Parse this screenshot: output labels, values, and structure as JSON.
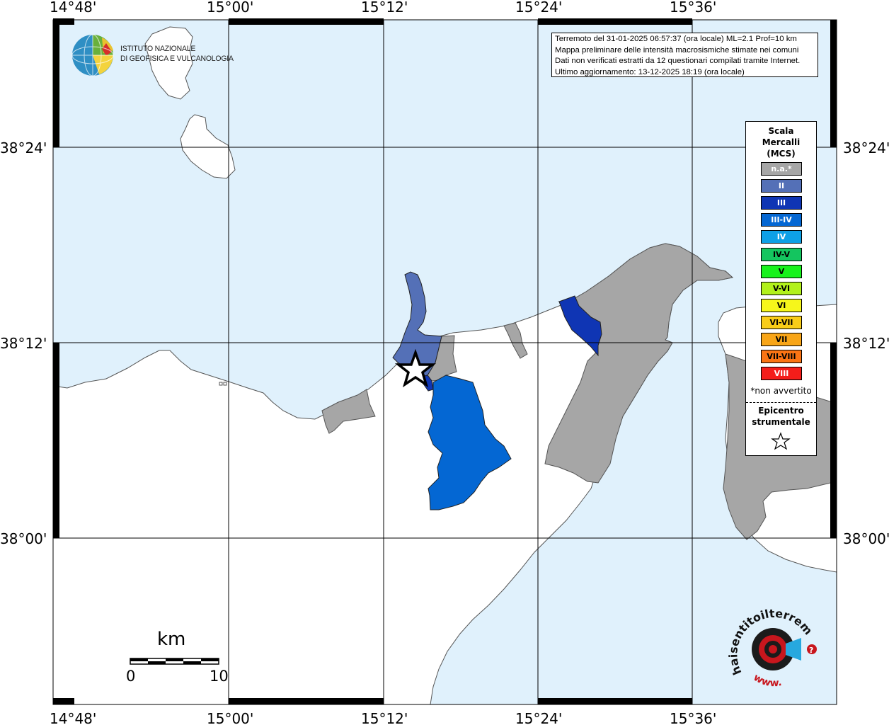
{
  "map": {
    "lon_labels": [
      "14°48'",
      "15°00'",
      "15°12'",
      "15°24'",
      "15°36'"
    ],
    "lat_labels": [
      "38°24'",
      "38°12'",
      "38°00'"
    ],
    "epicenter_marker": "star-icon",
    "colors": {
      "sea": "#e0f1fc",
      "land": "#ffffff",
      "not_felt": "#a6a6a6",
      "intensity_II": "#5470b7",
      "intensity_III": "#0f35b4",
      "intensity_III_IV": "#0467d3"
    }
  },
  "info": {
    "line1": "Terremoto del 31-01-2025 06:57:37 (ora locale) ML=2.1 Prof=10 km",
    "line2": "Mappa preliminare delle intensità macrosismiche stimate nei comuni",
    "line3": "Dati non verificati estratti da 12 questionari compilati tramite Internet.",
    "line4": "Ultimo aggiornamento: 13-12-2025 18:19 (ora locale)"
  },
  "legend": {
    "title_line1": "Scala",
    "title_line2": "Mercalli",
    "title_line3": "(MCS)",
    "items": [
      {
        "label": "n.a.*",
        "color": "#a6a6a6",
        "text_color": "#ffffff"
      },
      {
        "label": "II",
        "color": "#5470b7",
        "text_color": "#ffffff"
      },
      {
        "label": "III",
        "color": "#0f35b4",
        "text_color": "#ffffff"
      },
      {
        "label": "III-IV",
        "color": "#0467d3",
        "text_color": "#ffffff"
      },
      {
        "label": "IV",
        "color": "#0ea0e6",
        "text_color": "#ffffff"
      },
      {
        "label": "IV-V",
        "color": "#14c55f",
        "text_color": "#000000"
      },
      {
        "label": "V",
        "color": "#17f21c",
        "text_color": "#000000"
      },
      {
        "label": "V-VI",
        "color": "#b2f11b",
        "text_color": "#000000"
      },
      {
        "label": "VI",
        "color": "#f6f61b",
        "text_color": "#000000"
      },
      {
        "label": "VI-VII",
        "color": "#f9cd18",
        "text_color": "#000000"
      },
      {
        "label": "VII",
        "color": "#f8a517",
        "text_color": "#000000"
      },
      {
        "label": "VII-VIII",
        "color": "#fa7414",
        "text_color": "#000000"
      },
      {
        "label": "VIII",
        "color": "#f41d1a",
        "text_color": "#ffffff"
      }
    ],
    "note": "*non avvertito",
    "epicenter_line1": "Epicentro",
    "epicenter_line2": "strumentale"
  },
  "logos": {
    "ingv_line1": "ISTITUTO NAZIONALE",
    "ingv_line2": "DI GEOFISICA E VULCANOLOGIA",
    "hsit_arc": "haisentitoilterremoto.it",
    "hsit_www": "www."
  },
  "scale_bar": {
    "unit": "km",
    "start": "0",
    "end": "10"
  }
}
